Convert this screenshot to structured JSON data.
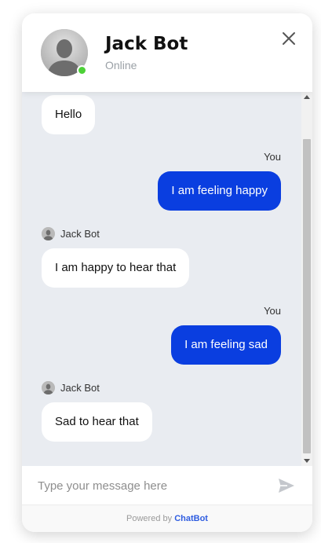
{
  "header": {
    "bot_name": "Jack Bot",
    "status": "Online",
    "status_color": "#4cd137",
    "avatar_icon": "user-silhouette-icon",
    "close_icon": "close-icon"
  },
  "messages": [
    {
      "from": "bot",
      "sender": "",
      "text": "Hello"
    },
    {
      "from": "user",
      "sender": "You",
      "text": "I am feeling happy"
    },
    {
      "from": "bot",
      "sender": "Jack Bot",
      "text": "I am happy to hear that"
    },
    {
      "from": "user",
      "sender": "You",
      "text": "I am feeling sad"
    },
    {
      "from": "bot",
      "sender": "Jack Bot",
      "text": "Sad to hear that"
    }
  ],
  "input": {
    "placeholder": "Type your message here",
    "value": "",
    "send_icon": "send-icon"
  },
  "footer": {
    "prefix": "Powered by",
    "brand": "ChatBot"
  },
  "colors": {
    "user_bubble": "#0a3ee0",
    "bot_bubble": "#ffffff",
    "chat_background": "#e9ecf1",
    "brand_link": "#2f5de0"
  }
}
